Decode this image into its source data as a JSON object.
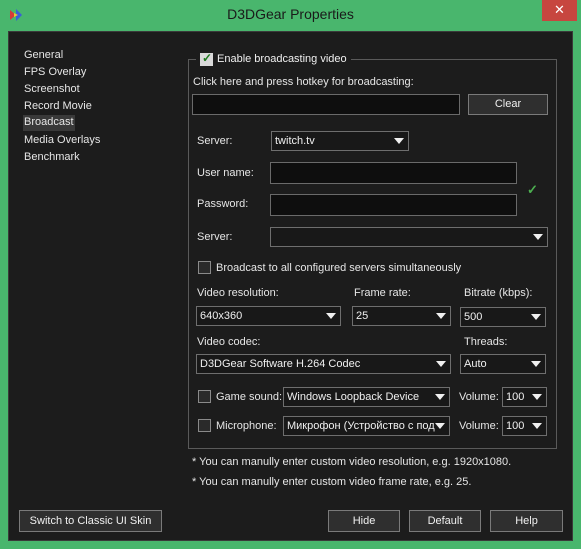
{
  "window": {
    "title": "D3DGear Properties",
    "close_glyph": "✕",
    "app_icon": "d3dgear-logo-icon"
  },
  "nav": {
    "items": [
      {
        "label": "General"
      },
      {
        "label": "FPS Overlay"
      },
      {
        "label": "Screenshot"
      },
      {
        "label": "Record Movie"
      },
      {
        "label": "Broadcast",
        "selected": true
      },
      {
        "label": "Media Overlays"
      },
      {
        "label": "Benchmark"
      }
    ]
  },
  "broadcast": {
    "enable_label": "Enable broadcasting video",
    "enable_checked": true,
    "hotkey_label": "Click here and press hotkey for broadcasting:",
    "hotkey_value": "",
    "clear_label": "Clear",
    "server_label": "Server:",
    "server_value": "twitch.tv",
    "username_label": "User name:",
    "username_value": "",
    "password_label": "Password:",
    "password_value": "",
    "server2_label": "Server:",
    "server2_value": "",
    "all_servers_label": "Broadcast to all configured servers simultaneously",
    "all_servers_checked": false,
    "resolution_label": "Video resolution:",
    "resolution_value": "640x360",
    "framerate_label": "Frame rate:",
    "framerate_value": "25",
    "bitrate_label": "Bitrate (kbps):",
    "bitrate_value": "500",
    "codec_label": "Video codec:",
    "codec_value": "D3DGear Software H.264 Codec",
    "threads_label": "Threads:",
    "threads_value": "Auto",
    "game_sound_label": "Game sound:",
    "game_sound_checked": false,
    "game_sound_device": "Windows Loopback Device",
    "game_volume_label": "Volume:",
    "game_volume_value": "100",
    "mic_label": "Microphone:",
    "mic_checked": false,
    "mic_device": "Микрофон (Устройство с под",
    "mic_volume_label": "Volume:",
    "mic_volume_value": "100"
  },
  "notes": {
    "resolution_note": "* You can manully enter custom video resolution, e.g. 1920x1080.",
    "framerate_note": "* You can manully enter custom video frame rate, e.g. 25."
  },
  "footer": {
    "classic_skin_label": "Switch to Classic UI Skin",
    "hide_label": "Hide",
    "default_label": "Default",
    "help_label": "Help"
  },
  "colors": {
    "titlebar": "#49b66d",
    "client_bg": "#1c1c1c",
    "close_button": "#c7463f",
    "valid_check": "#4caf50"
  }
}
